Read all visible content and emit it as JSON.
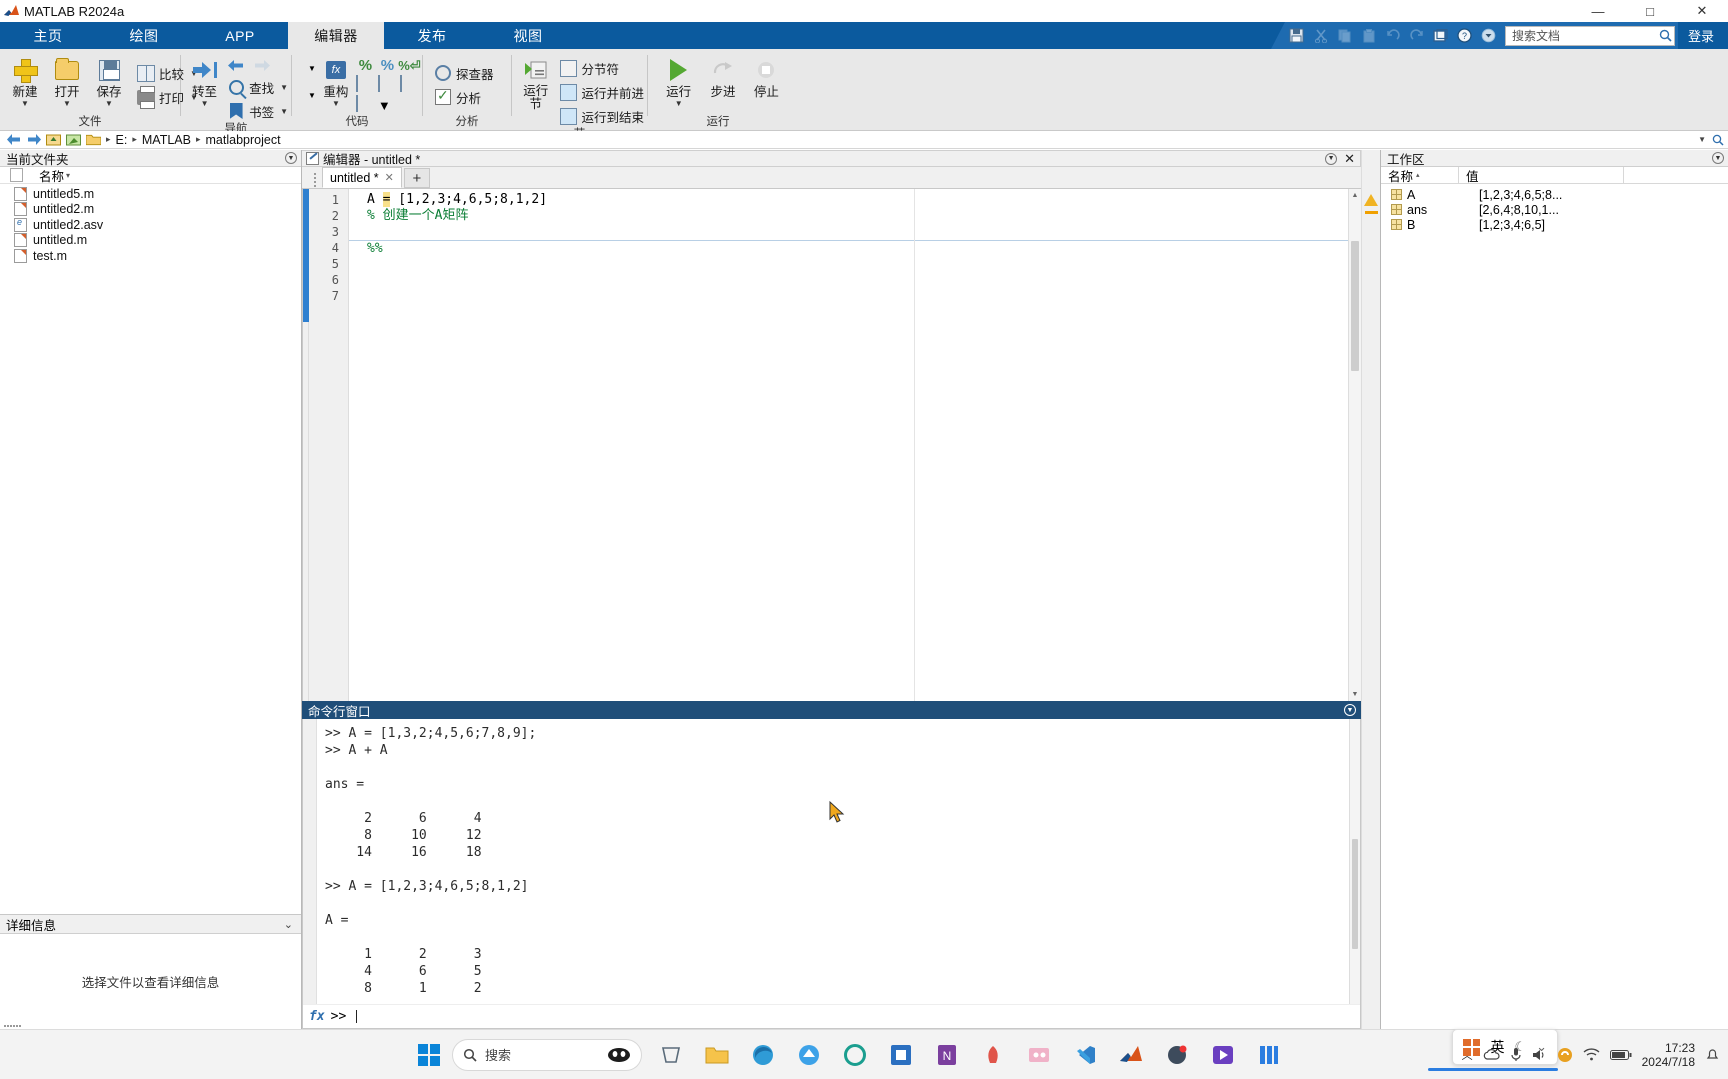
{
  "window": {
    "title": "MATLAB R2024a",
    "minimize": "—",
    "maximize": "□",
    "close": "✕"
  },
  "ribbon_tabs": [
    {
      "label": "主页",
      "active": false
    },
    {
      "label": "绘图",
      "active": false
    },
    {
      "label": "APP",
      "active": false
    },
    {
      "label": "编辑器",
      "active": true
    },
    {
      "label": "发布",
      "active": false
    },
    {
      "label": "视图",
      "active": false
    }
  ],
  "quickbar": {
    "icons": [
      "save-icon",
      "cut-icon",
      "copy-icon",
      "paste-icon",
      "undo-icon",
      "redo-icon",
      "layout-icon",
      "help-icon",
      "more-icon"
    ],
    "search_placeholder": "搜索文档",
    "signin_label": "登录"
  },
  "ribbon_groups": [
    {
      "name": "文件",
      "big": [
        {
          "label": "新建",
          "icon": "plus-icon",
          "caret": "▼"
        },
        {
          "label": "打开",
          "icon": "folder-icon",
          "caret": "▼"
        },
        {
          "label": "保存",
          "icon": "save-icon",
          "caret": "▼"
        }
      ],
      "small": [
        {
          "label": "比较",
          "icon": "compare-icon",
          "caret": "▼"
        },
        {
          "label": "打印",
          "icon": "printer-icon",
          "caret": "▼"
        }
      ]
    },
    {
      "name": "导航",
      "big": [
        {
          "label": "转至",
          "icon": "goto-icon",
          "caret": "▼"
        }
      ],
      "small": [
        {
          "label": "",
          "icon": "back-forward-icons",
          "caret": ""
        },
        {
          "label": "查找",
          "icon": "search-icon",
          "caret": "▼"
        },
        {
          "label": "书签",
          "icon": "bookmark-icon",
          "caret": "▼"
        }
      ]
    },
    {
      "name": "代码",
      "big": [
        {
          "label": "重构",
          "icon": "refactor-fx-icon",
          "caret": "▼"
        }
      ],
      "small": [
        {
          "label": "",
          "icon": "comment-icon",
          "caret": ""
        },
        {
          "label": "",
          "icon": "uncomment-icon",
          "caret": ""
        },
        {
          "label": "",
          "icon": "wrap-comment-icon",
          "caret": ""
        },
        {
          "label": "",
          "icon": "smart-indent-icon",
          "caret": ""
        },
        {
          "label": "",
          "icon": "indent-right-icon",
          "caret": ""
        },
        {
          "label": "",
          "icon": "indent-left-icon",
          "caret": ""
        },
        {
          "label": "",
          "icon": "function-icon",
          "caret": "▼"
        }
      ]
    },
    {
      "name": "分析",
      "small": [
        {
          "label": "探查器",
          "icon": "profiler-icon",
          "caret": ""
        },
        {
          "label": "分析",
          "icon": "analyze-icon",
          "caret": ""
        }
      ]
    },
    {
      "name": "节",
      "big": [
        {
          "label": "运行\n节",
          "icon": "run-section-icon",
          "caret": ""
        }
      ],
      "small": [
        {
          "label": "分节符",
          "icon": "section-break-icon",
          "caret": ""
        },
        {
          "label": "运行并前进",
          "icon": "run-advance-icon",
          "caret": ""
        },
        {
          "label": "运行到结束",
          "icon": "run-to-end-icon",
          "caret": ""
        }
      ]
    },
    {
      "name": "运行",
      "big": [
        {
          "label": "运行",
          "icon": "run-icon",
          "caret": "▼"
        },
        {
          "label": "步进",
          "icon": "step-icon",
          "caret": ""
        },
        {
          "label": "停止",
          "icon": "stop-icon",
          "caret": ""
        }
      ]
    }
  ],
  "pathbar": {
    "back_icon": "back-arrow-icon",
    "forward_icon": "forward-arrow-icon",
    "up_icon": "up-folder-icon",
    "browse_icon": "browse-folder-icon",
    "folder_icon": "folder-icon",
    "crumbs": [
      "E:",
      "MATLAB",
      "matlabproject"
    ],
    "separator": "▸"
  },
  "current_folder": {
    "title": "当前文件夹",
    "column_header": "名称",
    "sort_arrow": "▾",
    "files": [
      {
        "name": "untitled5.m",
        "type": "m"
      },
      {
        "name": "untitled2.m",
        "type": "m"
      },
      {
        "name": "untitled2.asv",
        "type": "asv"
      },
      {
        "name": "untitled.m",
        "type": "m"
      },
      {
        "name": "test.m",
        "type": "m"
      }
    ]
  },
  "details": {
    "title": "详细信息",
    "collapse_icon": "chevron-down-icon",
    "empty_text": "选择文件以查看详细信息"
  },
  "editor": {
    "panel_title": "编辑器 - untitled *",
    "tab_label": "untitled *",
    "tab_close": "✕",
    "new_tab": "+",
    "line_numbers": [
      "1",
      "2",
      "3",
      "4",
      "5",
      "6",
      "7"
    ],
    "lines": [
      {
        "n": 1,
        "text": "A = [1,2,3;4,6,5;8,1,2]",
        "kind": "code"
      },
      {
        "n": 2,
        "text": "% 创建一个A矩阵",
        "kind": "comment"
      },
      {
        "n": 3,
        "text": "",
        "kind": "code"
      },
      {
        "n": 4,
        "text": "%%",
        "kind": "section"
      },
      {
        "n": 5,
        "text": "",
        "kind": "code"
      },
      {
        "n": 6,
        "text": "",
        "kind": "code"
      },
      {
        "n": 7,
        "text": "",
        "kind": "code"
      }
    ]
  },
  "command_window": {
    "title": "命令行窗口",
    "lines": [
      ">> A = [1,3,2;4,5,6;7,8,9];",
      ">> A + A",
      "",
      "ans =",
      "",
      "     2      6      4",
      "     8     10     12",
      "    14     16     18",
      "",
      ">> A = [1,2,3;4,6,5;8,1,2]",
      "",
      "A =",
      "",
      "     1      2      3",
      "     4      6      5",
      "     8      1      2"
    ],
    "prompt": ">>",
    "fx_label": "fx"
  },
  "workspace": {
    "title": "工作区",
    "columns": [
      "名称",
      "值"
    ],
    "sort_arrow": "▴",
    "rows": [
      {
        "name": "A",
        "value": "[1,2,3;4,6,5;8..."
      },
      {
        "name": "ans",
        "value": "[2,6,4;8,10,1..."
      },
      {
        "name": "B",
        "value": "[1,2;3,4;6,5]"
      }
    ]
  },
  "analyzer": {
    "warning_icon": "warning-triangle-icon",
    "marker_icon": "orange-dash-icon"
  },
  "taskbar": {
    "start_icon": "windows-logo-icon",
    "search_placeholder": "搜索",
    "search_icon": "search-icon",
    "apps": [
      "copilot-icon",
      "widgets-icon",
      "explorer-icon",
      "edge-icon",
      "firefox-icon",
      "app5-icon",
      "app6-icon",
      "onenote-icon",
      "app8-icon",
      "app9-icon",
      "vscode-icon",
      "matlab-icon",
      "app12-icon",
      "media-icon",
      "app14-icon"
    ],
    "ime": {
      "lang": "英",
      "mode_icon": "moon-icon",
      "grid_icon": "ime-grid-icon"
    },
    "tray": [
      "chevron-up-icon",
      "cloud-icon",
      "mic-icon",
      "volume-icon",
      "sogou-icon",
      "wifi-icon",
      "battery-icon",
      "notification-icon"
    ],
    "clock_time": "17:23",
    "clock_date": "2024/7/18"
  }
}
